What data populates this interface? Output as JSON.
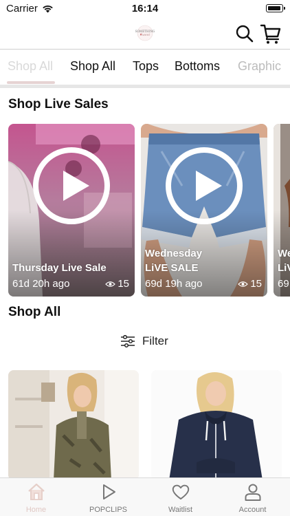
{
  "status_bar": {
    "carrier": "Carrier",
    "time": "16:14"
  },
  "header": {
    "logo_text": "SOMETHING Sweet",
    "search_icon": "search-icon",
    "cart_icon": "cart-icon"
  },
  "tabs": [
    "Shop All",
    "Shop All",
    "Tops",
    "Bottoms",
    "Graphic"
  ],
  "sections": {
    "live_sales": "Shop Live Sales",
    "shop_all": "Shop All"
  },
  "live_sales": [
    {
      "title_line1": "Thursday Live Sale",
      "title_line2": "",
      "ago": "61d 20h ago",
      "views": "15"
    },
    {
      "title_line1": "Wednesday",
      "title_line2": "LiVE SALE",
      "ago": "69d 19h ago",
      "views": "15"
    },
    {
      "title_line1": "We",
      "title_line2": "LiV",
      "ago": "69",
      "views": ""
    }
  ],
  "filter": {
    "label": "Filter"
  },
  "bottom_nav": [
    {
      "label": "Home",
      "icon": "home-icon",
      "active": true
    },
    {
      "label": "POPCLIPS",
      "icon": "play-icon",
      "active": false
    },
    {
      "label": "Waitlist",
      "icon": "heart-icon",
      "active": false
    },
    {
      "label": "Account",
      "icon": "user-icon",
      "active": false
    }
  ],
  "colors": {
    "accent_inactive": "#e0c8c4",
    "tab_underline": "#e6d3d3"
  }
}
